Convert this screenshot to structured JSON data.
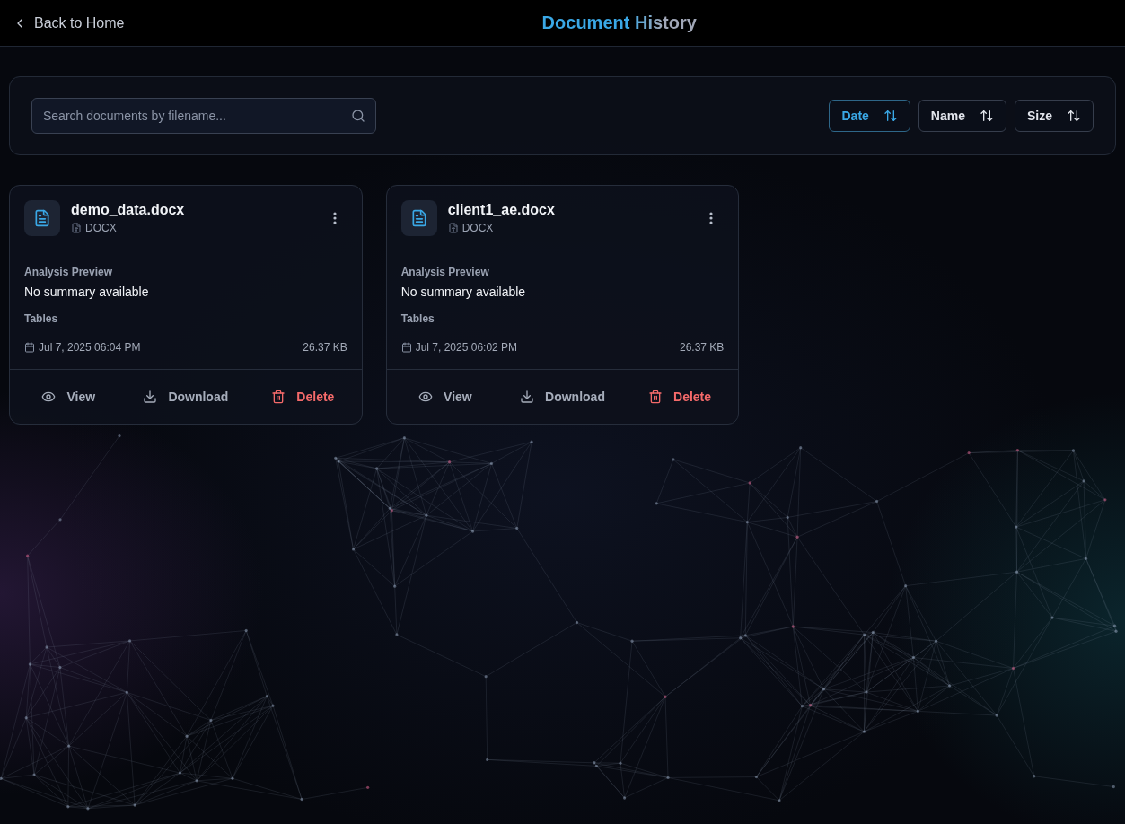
{
  "header": {
    "back_link": "Back to Home",
    "title": "Document History"
  },
  "toolbar": {
    "search": {
      "placeholder": "Search documents by filename..."
    },
    "sort_options": [
      {
        "label": "Date",
        "selected": true
      },
      {
        "label": "Name",
        "selected": false
      },
      {
        "label": "Size",
        "selected": false
      }
    ]
  },
  "documents": [
    {
      "filename": "demo_data.docx",
      "file_type": "DOCX",
      "preview_label": "Analysis Preview",
      "summary": "No summary available",
      "section_label": "Tables",
      "date": "Jul 7, 2025 06:04 PM",
      "size": "26.37 KB",
      "actions": [
        {
          "kind": "view",
          "label": "View"
        },
        {
          "kind": "download",
          "label": "Download"
        },
        {
          "kind": "delete",
          "label": "Delete"
        }
      ]
    },
    {
      "filename": "client1_ae.docx",
      "file_type": "DOCX",
      "preview_label": "Analysis Preview",
      "summary": "No summary available",
      "section_label": "Tables",
      "date": "Jul 7, 2025 06:02 PM",
      "size": "26.37 KB",
      "actions": [
        {
          "kind": "view",
          "label": "View"
        },
        {
          "kind": "download",
          "label": "Download"
        },
        {
          "kind": "delete",
          "label": "Delete"
        }
      ]
    }
  ]
}
